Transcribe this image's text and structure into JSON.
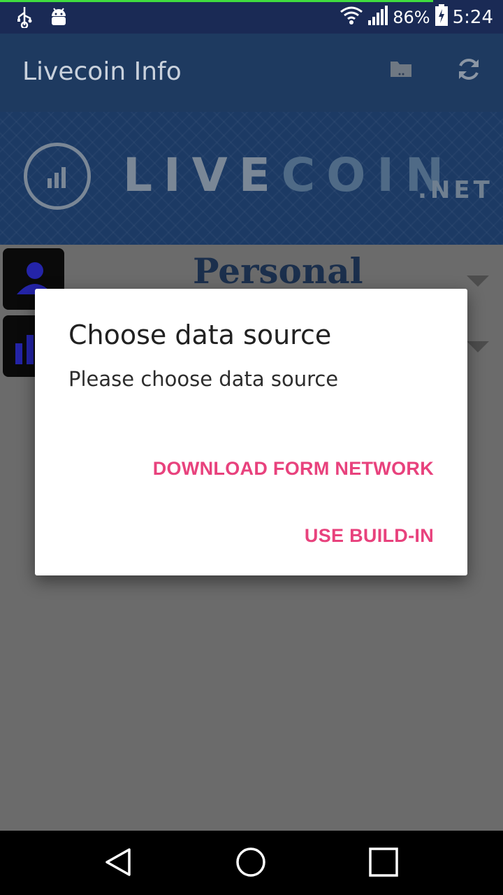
{
  "status_bar": {
    "battery": "86%",
    "time": "5:24"
  },
  "app_bar": {
    "title": "Livecoin Info"
  },
  "banner": {
    "brand_main": "LIVE",
    "brand_accent": "COIN",
    "brand_suffix": ".NET"
  },
  "content": {
    "row1_label": "Personal"
  },
  "dialog": {
    "title": "Choose data source",
    "message": "Please choose data source",
    "button_network": "DOWNLOAD FORM NETWORK",
    "button_builtin": "USE BUILD-IN"
  },
  "colors": {
    "accent": "#e8427d",
    "app_bar": "#1e3a60",
    "status_bar": "#1a2a55"
  }
}
